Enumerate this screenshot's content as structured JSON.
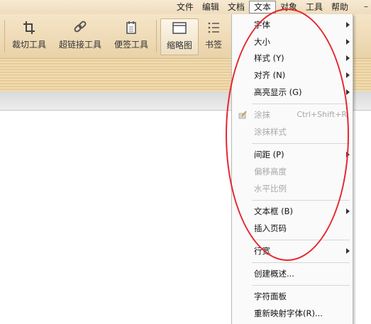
{
  "menubar": {
    "items": [
      {
        "label": "文件"
      },
      {
        "label": "编辑"
      },
      {
        "label": "文档"
      },
      {
        "label": "文本",
        "active": true
      },
      {
        "label": "对象"
      },
      {
        "label": "工具"
      },
      {
        "label": "帮助"
      }
    ],
    "minimize": "–"
  },
  "toolbar": {
    "crop": "裁切工具",
    "hyperlink": "超链接工具",
    "note": "便签工具",
    "thumbnail": "缩略图",
    "bookmark": "书签"
  },
  "text_menu": {
    "items": [
      {
        "label": "字体",
        "submenu": true
      },
      {
        "label": "大小",
        "submenu": true
      },
      {
        "label": "样式 (Y)",
        "submenu": true
      },
      {
        "label": "对齐 (N)",
        "submenu": true
      },
      {
        "label": "高亮显示 (G)",
        "submenu": true
      },
      {
        "label": "涂抹",
        "shortcut": "Ctrl+Shift+R",
        "disabled": true
      },
      {
        "label": "涂抹样式",
        "disabled": true
      },
      {
        "label": "间距 (P)",
        "submenu": true
      },
      {
        "label": "偏移高度",
        "disabled": true
      },
      {
        "label": "水平比例",
        "disabled": true
      },
      {
        "label": "文本框 (B)",
        "submenu": true
      },
      {
        "label": "插入页码"
      },
      {
        "label": "行宽",
        "submenu": true
      },
      {
        "label": "创建概述..."
      },
      {
        "label": "字符面板"
      },
      {
        "label": "重新映射字体(R)..."
      }
    ]
  },
  "colors": {
    "highlight_ellipse": "#e6262e",
    "toolbar_bg": "#f1dcb3"
  }
}
